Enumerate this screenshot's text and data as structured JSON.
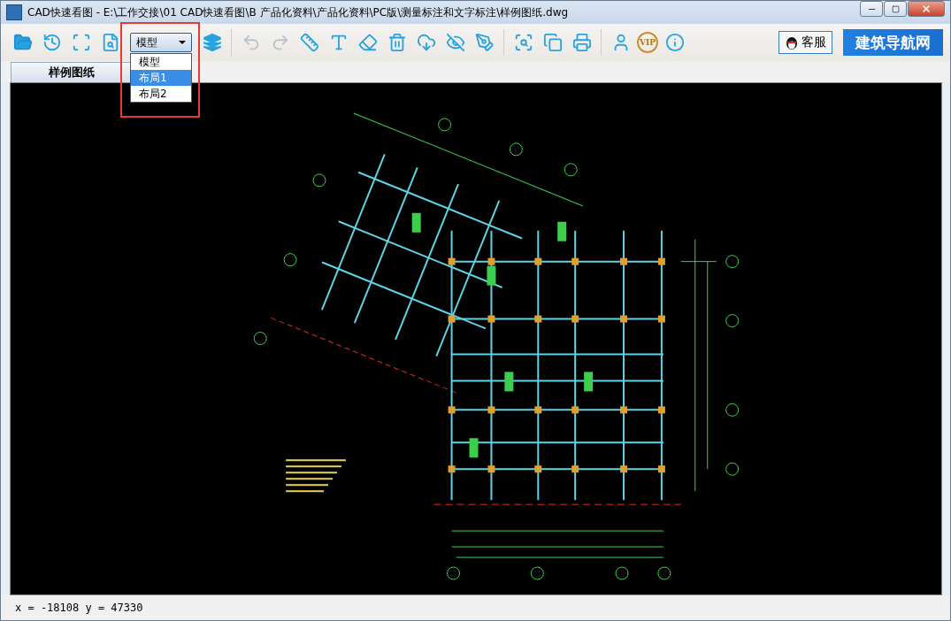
{
  "window": {
    "title": "CAD快速看图 - E:\\工作交接\\01 CAD快速看图\\B 产品化资料\\产品化资料\\PC版\\测量标注和文字标注\\样例图纸.dwg"
  },
  "toolbar": {
    "layout_select": {
      "value": "模型",
      "expanded": true,
      "options": [
        {
          "label": "模型",
          "highlighted": false
        },
        {
          "label": "布局1",
          "highlighted": true
        },
        {
          "label": "布局2",
          "highlighted": false
        }
      ]
    },
    "vip_badge": "VIP",
    "service_button": "客服",
    "banner": "建筑导航网"
  },
  "tabs": [
    {
      "label": "样例图纸",
      "selected": true
    }
  ],
  "status_bar": {
    "coordinates": "x = -18108 y = 47330"
  }
}
